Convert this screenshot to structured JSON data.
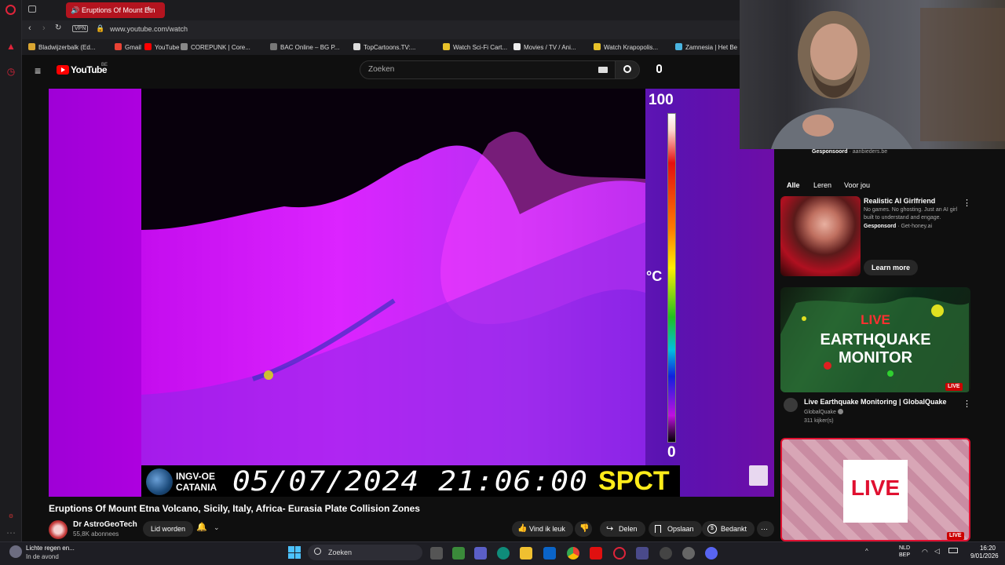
{
  "browser": {
    "active_tab_title": "Eruptions Of Mount Etn",
    "url": "www.youtube.com/watch",
    "vpn_label": "VPN",
    "bookmarks": [
      {
        "label": "Bladwijzerbalk (Ed...",
        "color": "#d9a531"
      },
      {
        "label": "Gmail",
        "color": "#ea4335"
      },
      {
        "label": "YouTube",
        "color": "#ff0000"
      },
      {
        "label": "COREPUNK | Core...",
        "color": "#888888"
      },
      {
        "label": "BAC Online – BG P...",
        "color": "#777777"
      },
      {
        "label": "TopCartoons.TV:...",
        "color": "#dddddd"
      },
      {
        "label": "Watch Sci-Fi Cart...",
        "color": "#e8c22a"
      },
      {
        "label": "Movies / TV / Ani...",
        "color": "#eeeeee"
      },
      {
        "label": "Watch Krapopolis...",
        "color": "#e8c22a"
      },
      {
        "label": "Zamnesia | Het Be",
        "color": "#4ab4e0"
      }
    ]
  },
  "youtube": {
    "logo_text": "YouTube",
    "region": "BE",
    "search_placeholder": "Zoeken"
  },
  "video": {
    "scale_max": "100",
    "scale_min": "0",
    "scale_unit": "°C",
    "overlay_org_line1": "INGV-OE",
    "overlay_org_line2": "CATANIA",
    "overlay_datetime": "05/07/2024 21:06:00",
    "overlay_station": "SPCT",
    "title": "Eruptions Of Mount Etna Volcano, Sicily, Italy, Africa- Eurasia Plate Collision Zones"
  },
  "channel": {
    "name": "Dr AstroGeoTech",
    "subscribers": "55,8K abonnees",
    "join_label": "Lid worden"
  },
  "actions": {
    "like": "Vind ik leuk",
    "share": "Delen",
    "save": "Opslaan",
    "thanks": "Bedankt"
  },
  "sidebar": {
    "sponsored_top": "Gesponsoord",
    "sponsored_top_domain": "aanbieders.be",
    "chips": [
      "Alle",
      "Leren",
      "Voor jou"
    ],
    "ad": {
      "title": "Realistic AI Girlfriend",
      "desc": "No games. No ghosting. Just an AI girl built to understand and engage.",
      "sponsored": "Gesponsord",
      "domain": "Get-honey.ai",
      "cta": "Learn more"
    },
    "live_video": {
      "thumb_line1": "LIVE",
      "thumb_line2": "EARTHQUAKE",
      "thumb_line3": "MONITOR",
      "badge": "LIVE",
      "title": "Live Earthquake Monitoring | GlobalQuake",
      "channel": "GlobalQuake",
      "viewers": "311 kijker(s)"
    },
    "live_video2": {
      "thumb_text": "LIVE",
      "badge": "LIVE"
    }
  },
  "taskbar": {
    "weather_line1": "Lichte regen en...",
    "weather_line2": "In de avond",
    "search_placeholder": "Zoeken",
    "lang_line1": "NLD",
    "lang_line2": "BEP",
    "time": "16:20",
    "date": "9/01/2026"
  }
}
